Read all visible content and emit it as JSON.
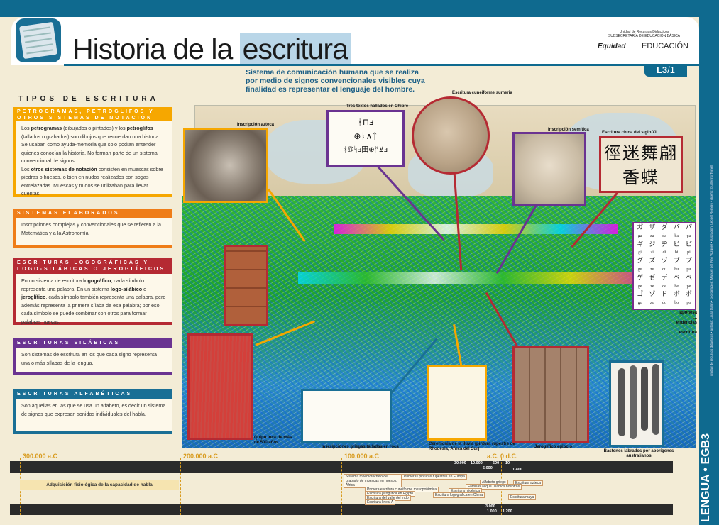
{
  "header": {
    "title_plain": "Historia de la ",
    "title_highlight": "escritura",
    "subtitle": "Sistema de comunicación humana que se realiza por medio de signos convencionales visibles cuya finalidad es representar el lenguaje del hombre.",
    "ministry_line1": "Unidad de Recursos Didácticos",
    "ministry_line2": "SUBSECRETARÍA DE EDUCACIÓN BÁSICA",
    "equidad": "Equidad",
    "ministerio": "EDUCACIÓN",
    "lamina": "L3",
    "lamina_page": "/1"
  },
  "types": {
    "heading": "TIPOS DE ESCRITURA",
    "items": [
      {
        "title": "PETROGRAMAS, PETROGLIFOS Y OTROS SISTEMAS DE NOTACIÓN",
        "color": "#f6a700",
        "body": [
          "Los petrogramas (dibujados o pintados) y los petroglifos (tallados o grabados) son dibujos que recuerdan una historia. Se usaban como ayuda-memoria que solo podían entender quienes conocían la historia. No forman parte de un sistema convencional de signos.",
          "Los otros sistemas de notación consisten en muescas sobre piedras o huesos, o bien en nudos realizados con sogas entrelazadas. Muescas y nudos se utilizaban para llevar cuentas."
        ]
      },
      {
        "title": "SISTEMAS ELABORADOS",
        "color": "#ef7d18",
        "body": [
          "Inscripciones complejas y convencionales que se refieren a la Matemática y a la Astronomía."
        ]
      },
      {
        "title": "ESCRITURAS LOGOGRÁFICAS Y LOGO-SILÁBICAS O JEROGLÍFICOS",
        "color": "#b52a33",
        "body": [
          "En un sistema de escritura logográfico, cada símbolo representa una palabra. En un sistema logo-silábico o jeroglífico, cada símbolo también representa una palabra, pero además representa la primera sílaba de esa palabra; por eso cada símbolo se puede combinar con otros para formar palabras nuevas."
        ]
      },
      {
        "title": "ESCRITURAS SILÁBICAS",
        "color": "#6a3391",
        "body": [
          "Son sistemas de escritura en los que cada signo representa una o más sílabas de la lengua."
        ]
      },
      {
        "title": "ESCRITURAS ALFABÉTICAS",
        "color": "#1a6f95",
        "body": [
          "Son aquellas en las que se usa un alfabeto, es decir un sistema de signos que expresan sonidos individuales del habla."
        ]
      }
    ]
  },
  "captions": {
    "azteca": "Inscripción azteca",
    "chipre": "Tres textos hallados en Chipre",
    "cuneiforme": "Escritura cuneiforme sumeria",
    "semitica": "Inscripción semítica",
    "china": "Escritura china del siglo XII",
    "japonesa": "japonesa ... endencias ... escritura",
    "quipu": "Quipu inca de más de 500 años",
    "griegas": "Inscripciones griegas talladas en roca",
    "lluvia": "Ceremonia de la lluvia (pintura rupestre de Rhodesia, África del Sur)",
    "egipcio": "Jeroglífico egipcio",
    "bastones": "Bastones labrados por aborígenes australianos"
  },
  "chinese_chars": "徑迷舞翩香蝶",
  "kana": [
    "ガ",
    "ザ",
    "ダ",
    "バ",
    "パ",
    "ga",
    "za",
    "da",
    "ba",
    "pa",
    "ギ",
    "ジ",
    "ヂ",
    "ビ",
    "ピ",
    "gi",
    "zi",
    "di",
    "bi",
    "pi",
    "グ",
    "ズ",
    "ヅ",
    "ブ",
    "プ",
    "gu",
    "zu",
    "du",
    "bu",
    "pu",
    "ゲ",
    "ゼ",
    "デ",
    "ベ",
    "ペ",
    "ge",
    "ze",
    "de",
    "be",
    "pe",
    "ゴ",
    "ゾ",
    "ド",
    "ボ",
    "ポ",
    "go",
    "zo",
    "do",
    "bo",
    "po"
  ],
  "chipre_lines": [
    "ᚼ⊓ⅎ",
    "⊕ᚭ⊼ᛏ",
    "ᚼⅅᛋⅎ田⊕ᛗ⊻ⅎ"
  ],
  "timeline": {
    "ticks": [
      "300.000 a.C",
      "200.000 a.C",
      "100.000 a.C",
      "a.C. 0 d.C."
    ],
    "acquisition": "Adquisición fisiológica de la capacidad de habla",
    "numbers_top": [
      "30.000",
      "10.000",
      "600",
      "10",
      "5.000",
      "1.400"
    ],
    "numbers_bottom": [
      "3.000",
      "1.000",
      "1.200"
    ],
    "events": [
      "Sistema mnemotécnico de grabado de muescas en huesos, África",
      "Primeras pinturas rupestres en Europa",
      "Alfabeto griego",
      "Escritura azteca",
      "Familias al que usamos nosotros",
      "Primera escritura cuneiforme mesopotámica",
      "Escritura jeroglífica en Egipto",
      "Escritura del valle del Indo",
      "Escritura lineal A",
      "Escritura micénica",
      "Escritura logográfica en China",
      "Escritura maya"
    ]
  },
  "side": {
    "subject": "LENGUA • EGB3",
    "credits": "unidad de recursos didácticos • autoría: Laura Darin • coordinación: Manuel del Pino Vazquez • ilustración: Leonel Romero • diseño: Guillermo Tomelli"
  }
}
